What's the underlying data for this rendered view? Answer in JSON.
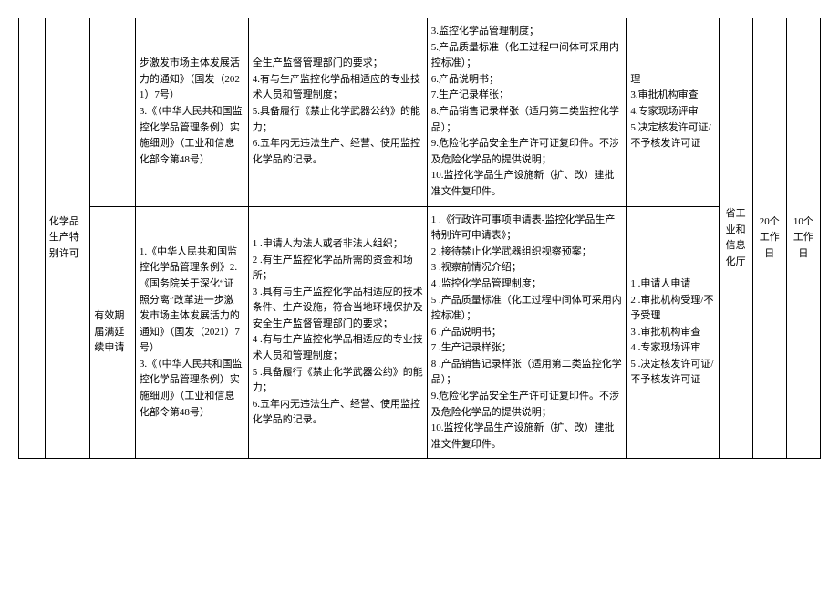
{
  "rows": {
    "top": {
      "col1": "",
      "name": "化学品生产特别许可",
      "sub": "",
      "basis": "步激发市场主体发展活力的通知》（国发（2021）7号）\n3.《（中华人民共和国监控化学品管理条例）实施细则》（工业和信息化部令第48号）",
      "cond": "全生产监督管理部门的要求；\n4.有与生产监控化学品相适应的专业技术人员和管理制度；\n5.具备履行《禁止化学武器公约》的能力；\n6.五年内无违法生产、经营、使用监控化学品的记录。",
      "material": "3.监控化学品管理制度；\n5.产品质量标准（化工过程中间体可采用内控标准）；\n6.产品说明书；\n7.生产记录样张；\n8.产品销售记录样张（适用第二类监控化学品）；\n9.危险化学品安全生产许可证复印件。不涉及危险化学品的提供说明；\n10.监控化学品生产设施新（扩、改）建批准文件复印件。",
      "proc": "理\n3.审批机构审查\n4.专家现场评审\n5.决定核发许可证/不予核发许可证",
      "dept": "",
      "days1": "",
      "days2": ""
    },
    "bottom": {
      "col1": "",
      "name": "",
      "sub": "有效期届满延续申请",
      "basis": "1.《中华人民共和国监控化学品管理条例》2.《国务院关于深化“证照分离”改革进一步激发市场主体发展活力的通知》（国发（2021）7号）\n3.《（中华人民共和国监控化学品管理条例）实施细则》（工业和信息化部令第48号）",
      "cond": "1      .申请人为法人或者非法人组织；\n2      .有生产监控化学品所需的资金和场所；\n3      .具有与生产监控化学品相适应的技术条件、生产设施，符合当地环境保护及安全生产监督管理部门的要求；\n4      .有与生产监控化学品相适应的专业技术人员和管理制度；\n5      .具备履行《禁止化学武器公约》的能力；\n6.五年内无违法生产、经营、使用监控化学品的记录。",
      "material": "1      .《行政许可事项申请表-监控化学品生产特别许可申请表》；\n2      .接待禁止化学武器组织视察预案；\n3      .视察前情况介绍；\n4      .监控化学品管理制度；\n5      .产品质量标准（化工过程中间体可采用内控标准）；\n6      .产品说明书；\n7      .生产记录样张；\n8      .产品销售记录样张（适用第二类监控化学品）；\n9.危险化学品安全生产许可证复印件。不涉及危险化学品的提供说明；\n10.监控化学品生产设施新（扩、改）建批准文件复印件。",
      "proc": "1      .申请人申请\n2      .审批机构受理/不予受理\n3      .审批机构审查\n4      .专家现场评审\n5      .决定核发许可证/不予核发许可证",
      "dept": "省工业和信息化厅",
      "days1": "20个工作日",
      "days2": "10个工作日"
    }
  }
}
